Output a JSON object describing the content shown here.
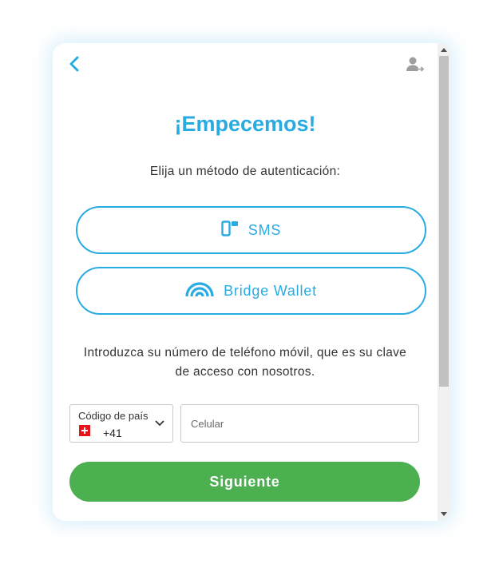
{
  "header": {
    "back_icon": "chevron-left-icon",
    "user_icon": "user-switch-icon"
  },
  "main": {
    "title": "¡Empecemos!",
    "subtitle": "Elija un método de autenticación:",
    "methods": [
      {
        "label": "SMS",
        "icon": "sms-device-icon"
      },
      {
        "label": "Bridge Wallet",
        "icon": "bridge-wallet-icon"
      }
    ],
    "intro_line1": "Introduzca su número de teléfono móvil, que es su clave",
    "intro_line2": "de acceso con nosotros.",
    "country": {
      "label": "Código de país",
      "code": "+41",
      "flag": "switzerland-flag-icon"
    },
    "phone": {
      "placeholder": "Celular",
      "value": ""
    },
    "next_label": "Siguiente"
  },
  "colors": {
    "accent": "#29abe2",
    "primary_button": "#4caf50",
    "text": "#333333"
  }
}
